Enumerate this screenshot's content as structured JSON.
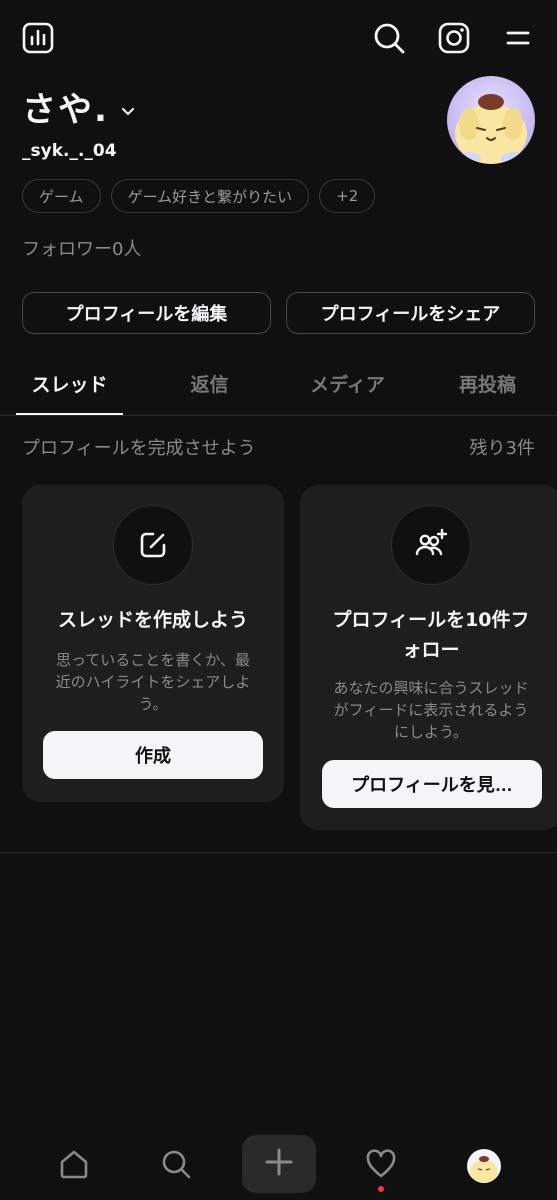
{
  "profile": {
    "display_name": "さや.",
    "username": "_syk._._04",
    "tags": [
      "ゲーム",
      "ゲーム好きと繋がりたい",
      "+2"
    ],
    "followers": "フォロワー0人",
    "edit_button": "プロフィールを編集",
    "share_button": "プロフィールをシェア"
  },
  "tabs": [
    {
      "label": "スレッド",
      "active": true
    },
    {
      "label": "返信",
      "active": false
    },
    {
      "label": "メディア",
      "active": false
    },
    {
      "label": "再投稿",
      "active": false
    }
  ],
  "completion": {
    "title": "プロフィールを完成させよう",
    "remaining": "残り3件",
    "cards": [
      {
        "icon": "compose-icon",
        "title": "スレッドを作成しよう",
        "desc_lines": [
          "思っていることを書くか、最",
          "近のハイライトをシェアしよ",
          "う。"
        ],
        "button": "作成"
      },
      {
        "icon": "follow-users-icon",
        "title_lines": [
          "プロフィールを10件フ",
          "ォロー"
        ],
        "desc_lines": [
          "あなたの興味に合うスレッド",
          "がフィードに表示されるよう",
          "にしよう。"
        ],
        "button": "プロフィールを見…"
      }
    ]
  },
  "icons": {
    "topbar": [
      "insights-icon",
      "search-icon",
      "instagram-icon",
      "menu-icon"
    ],
    "nav": [
      "home-icon",
      "search-icon",
      "plus-icon",
      "heart-icon",
      "profile-avatar"
    ]
  },
  "colors": {
    "background": "#101010",
    "card": "#1e1e1e",
    "text": "#f3f5f7",
    "muted": "#8a8a8a",
    "notification": "#ff3040"
  }
}
